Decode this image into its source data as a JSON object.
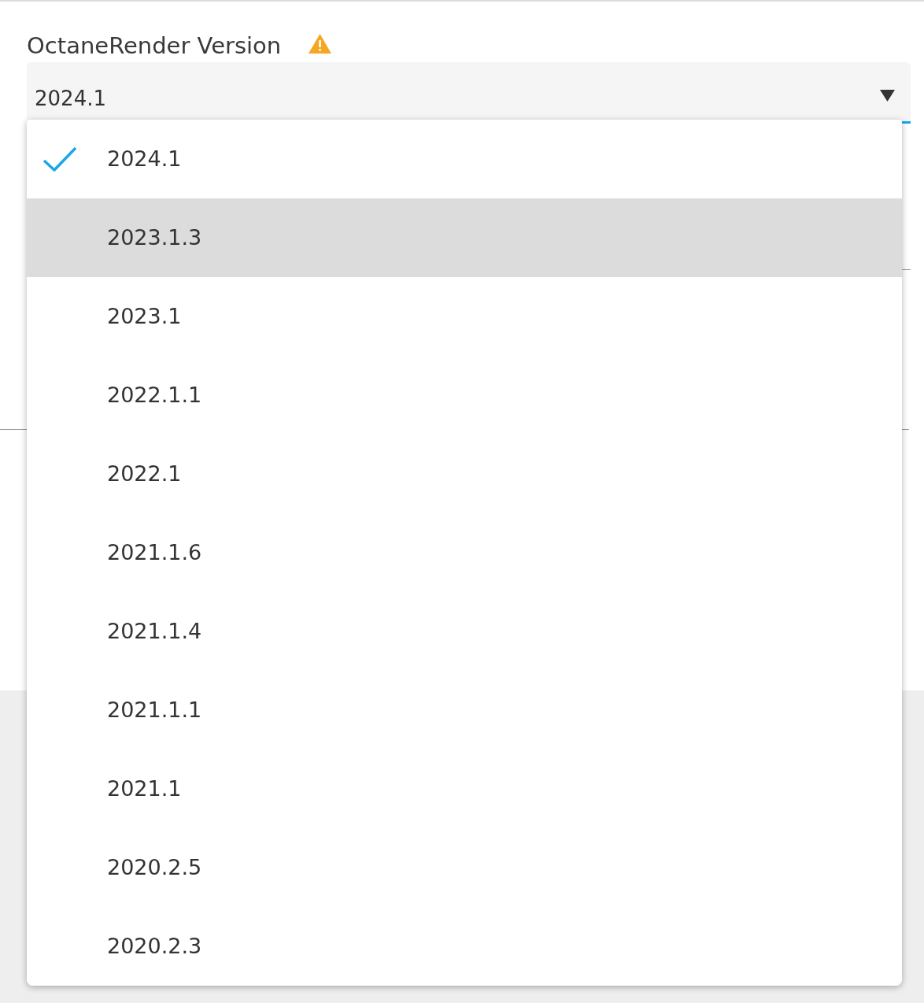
{
  "field": {
    "label": "OctaneRender Version",
    "warning": true,
    "value": "2024.1",
    "focused": true
  },
  "menu": {
    "items": [
      {
        "label": "2024.1",
        "selected": true,
        "highlighted": false
      },
      {
        "label": "2023.1.3",
        "selected": false,
        "highlighted": true
      },
      {
        "label": "2023.1",
        "selected": false,
        "highlighted": false
      },
      {
        "label": "2022.1.1",
        "selected": false,
        "highlighted": false
      },
      {
        "label": "2022.1",
        "selected": false,
        "highlighted": false
      },
      {
        "label": "2021.1.6",
        "selected": false,
        "highlighted": false
      },
      {
        "label": "2021.1.4",
        "selected": false,
        "highlighted": false
      },
      {
        "label": "2021.1.1",
        "selected": false,
        "highlighted": false
      },
      {
        "label": "2021.1",
        "selected": false,
        "highlighted": false
      },
      {
        "label": "2020.2.5",
        "selected": false,
        "highlighted": false
      },
      {
        "label": "2020.2.3",
        "selected": false,
        "highlighted": false
      }
    ]
  }
}
